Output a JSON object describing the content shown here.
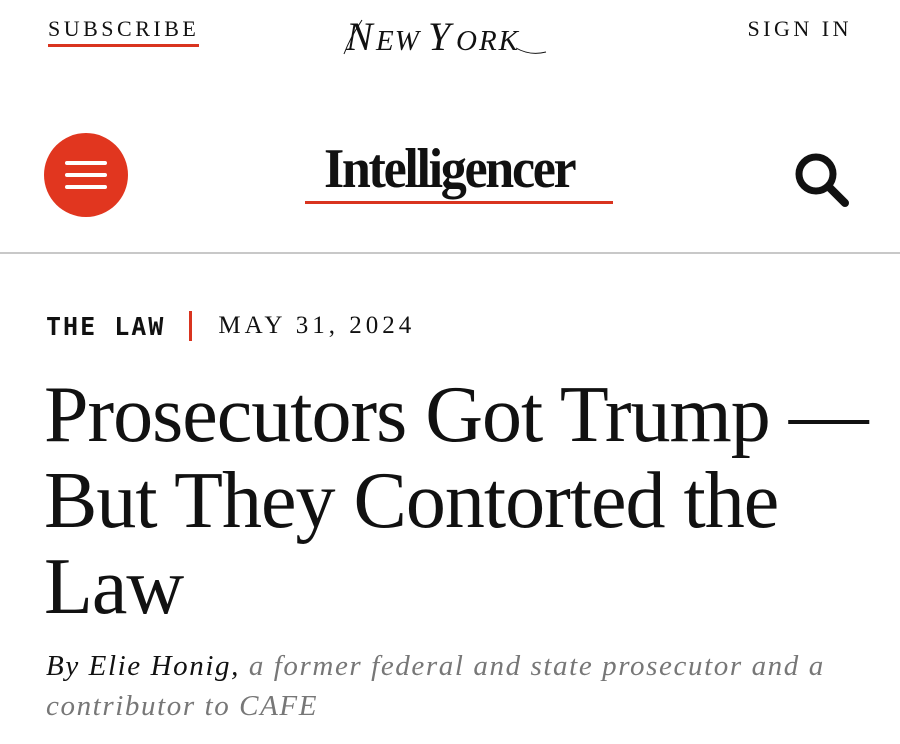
{
  "topbar": {
    "subscribe_label": "SUBSCRIBE",
    "logo_text": "NEW YORK",
    "signin_label": "SIGN IN"
  },
  "brand": {
    "name": "Intelligencer"
  },
  "icons": {
    "menu": "hamburger-menu-icon",
    "search": "search-icon"
  },
  "article": {
    "section": "THE LAW",
    "date": "MAY 31, 2024",
    "headline": "Prosecutors Got Trump — But They Contorted the Law",
    "byline_prefix": "By",
    "author": "Elie Honig,",
    "author_description": "a former federal and state prosecutor and a contributor to CAFE"
  },
  "colors": {
    "accent": "#e1361f",
    "text": "#111111",
    "muted": "#777777",
    "divider": "#c8c8c8"
  }
}
